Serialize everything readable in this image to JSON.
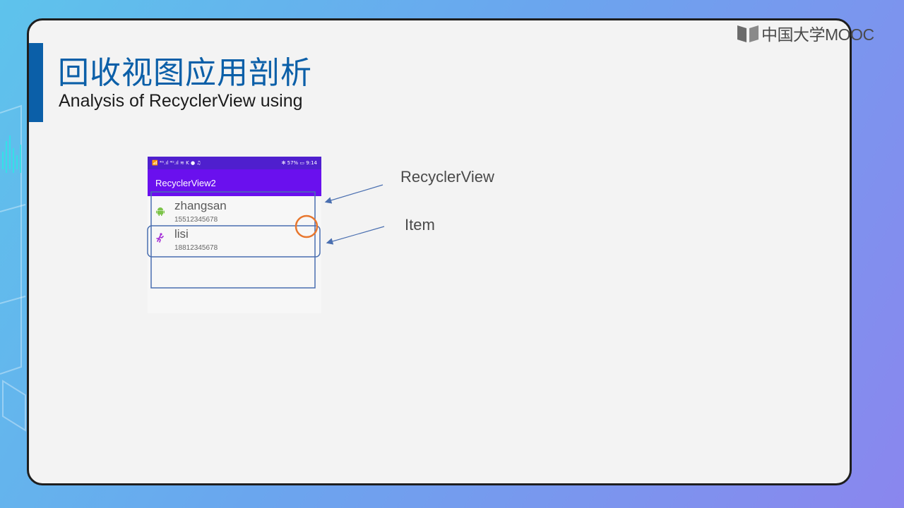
{
  "logo": {
    "text": "中国大学MOOC"
  },
  "slide": {
    "title": "回收视图应用剖析",
    "subtitle": "Analysis of RecyclerView using"
  },
  "phone": {
    "status_left": "📶 ⁴ᴳ.ıl ⁴ᴳ.ıl ≋ K ● ♫",
    "status_right": "✻ 57% ▭ 9:14",
    "app_title": "RecyclerView2",
    "items": [
      {
        "name": "zhangsan",
        "phone": "15512345678",
        "icon": "android-icon"
      },
      {
        "name": "lisi",
        "phone": "18812345678",
        "icon": "running-person-icon"
      }
    ]
  },
  "annotations": {
    "recycler_label": "RecyclerView",
    "item_label": "Item"
  },
  "colors": {
    "accent": "#0b5fa8",
    "app_bar": "#6a10ee",
    "annotation_box": "#4a6fb0",
    "highlight_circle": "#e8772e"
  }
}
